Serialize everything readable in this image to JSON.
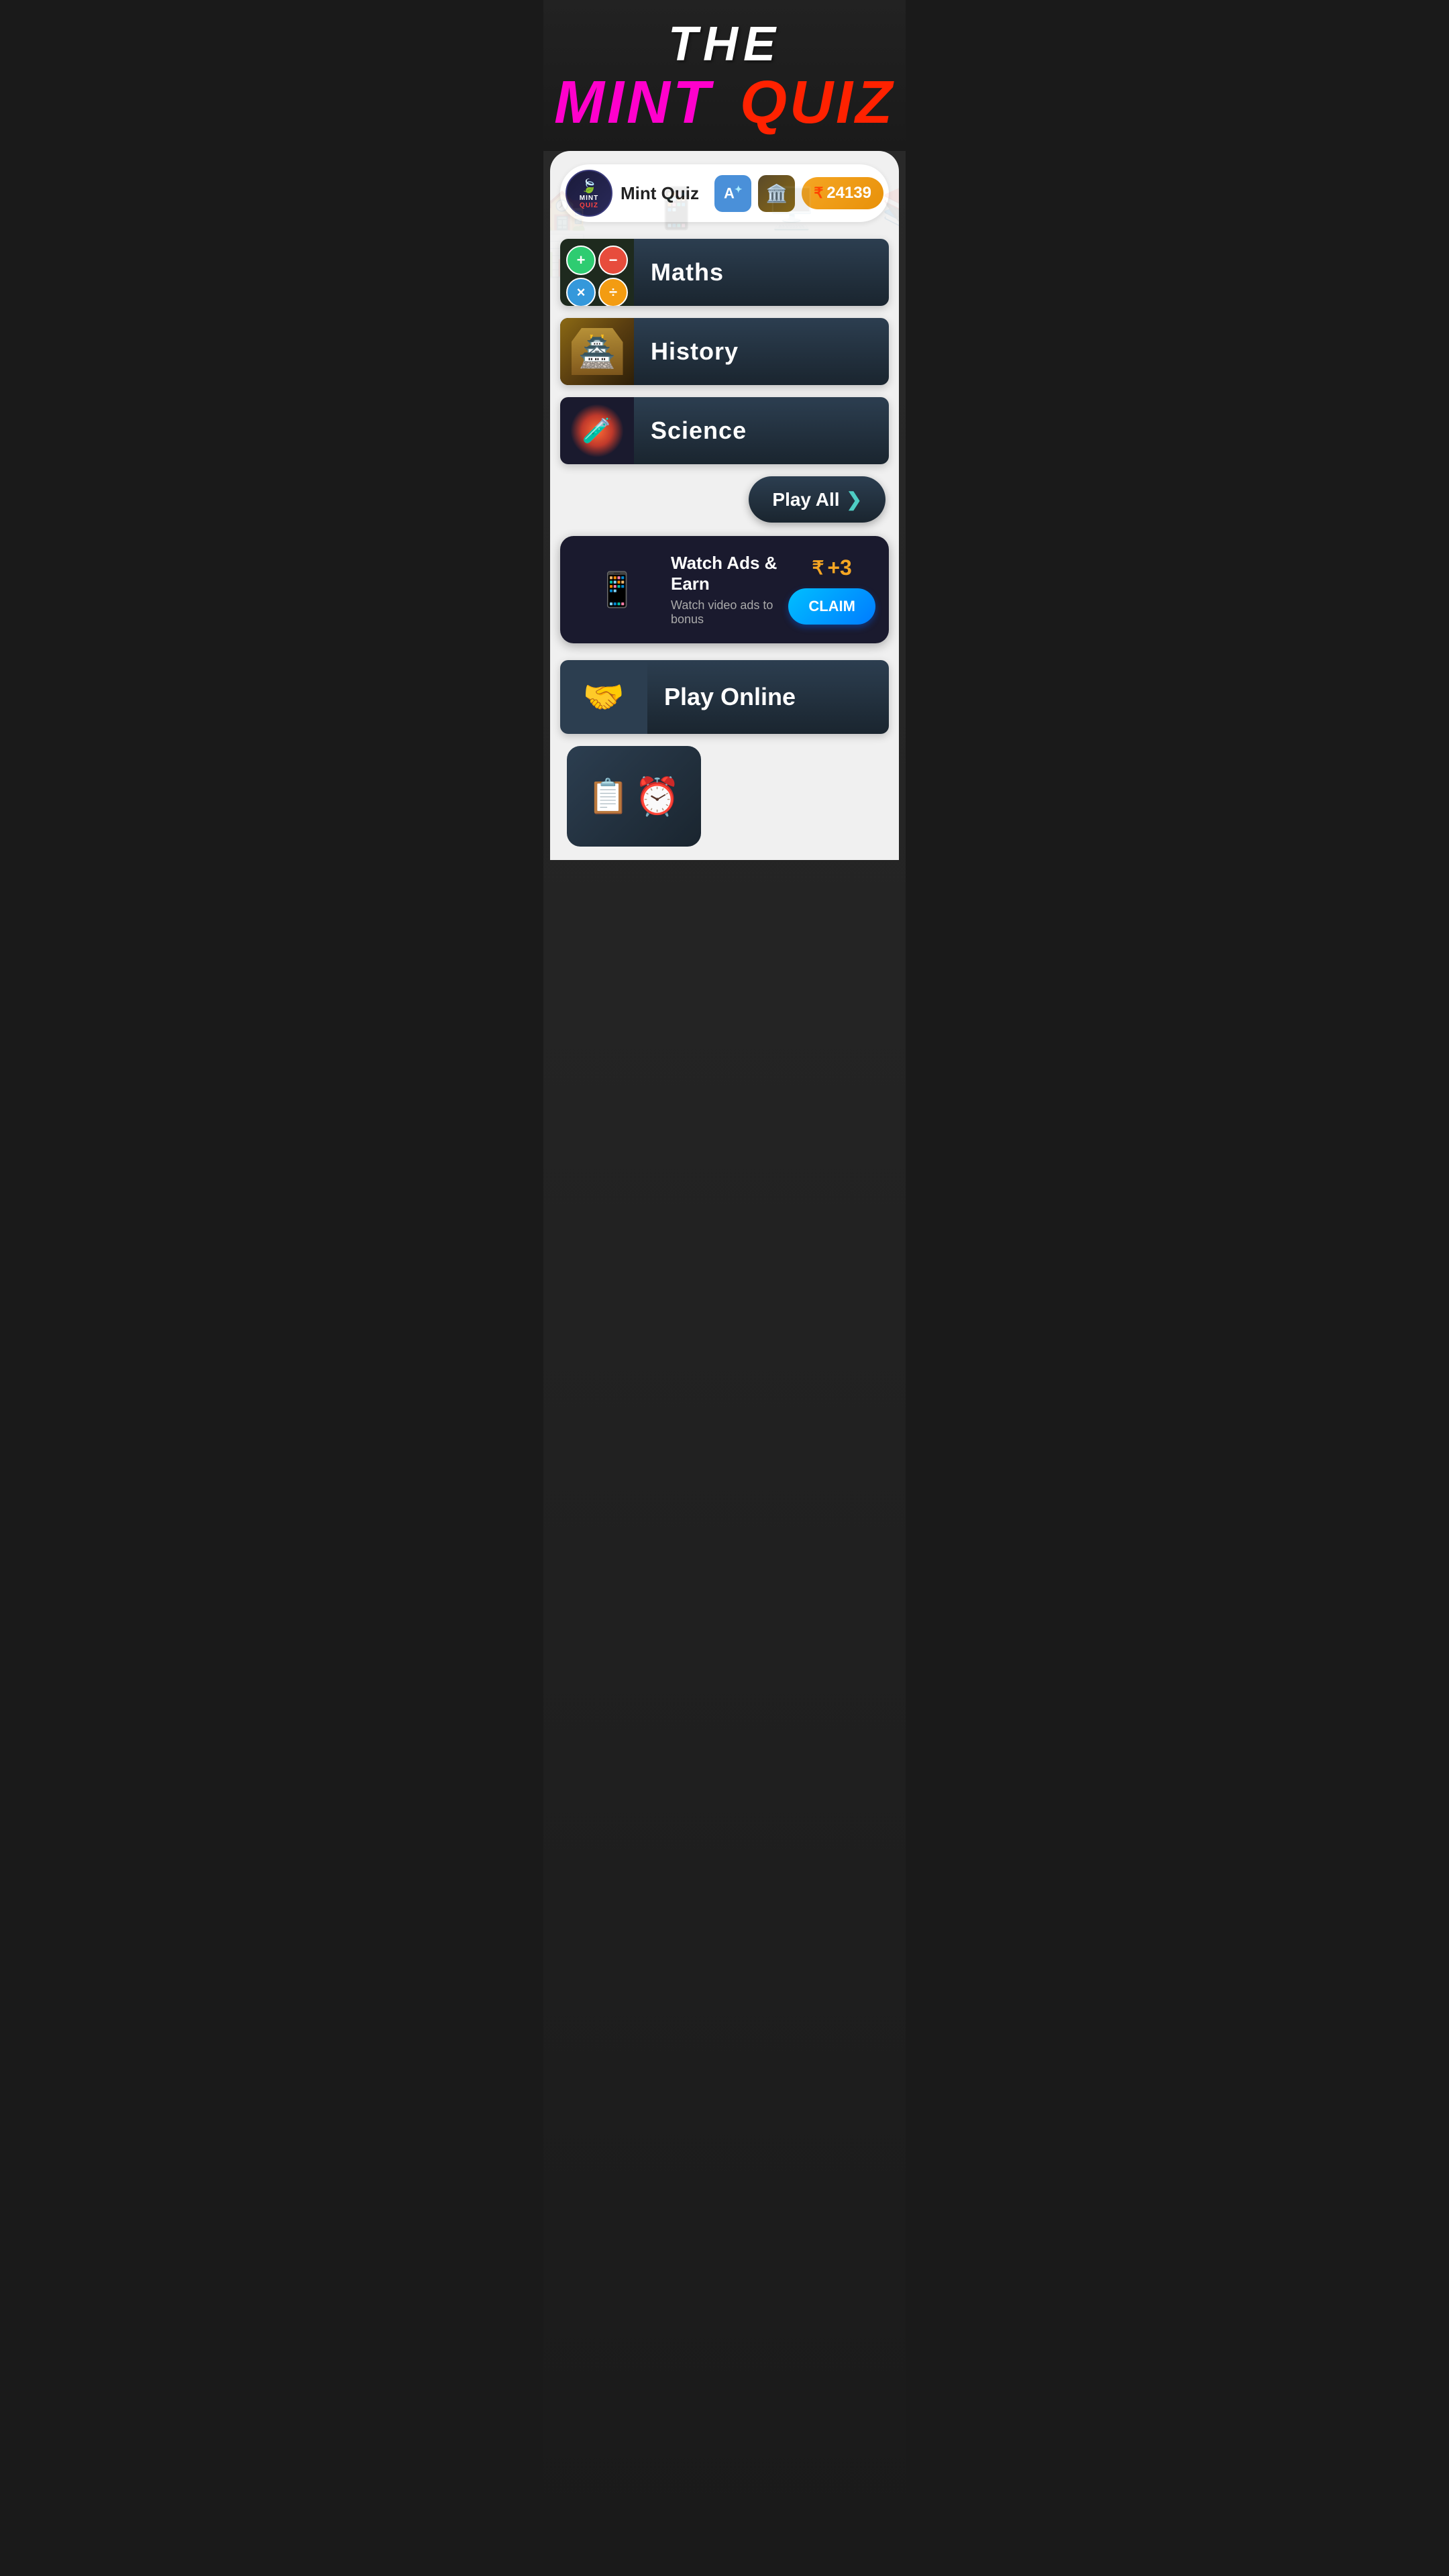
{
  "app": {
    "title": "THE",
    "title_mint": "MINT",
    "title_quiz": "QUIZ",
    "name": "Mint Quiz"
  },
  "header": {
    "coins": "24139",
    "rupee_symbol": "₹"
  },
  "categories": [
    {
      "id": "maths",
      "label": "Maths",
      "icon": "math-operations",
      "thumb_type": "maths"
    },
    {
      "id": "history",
      "label": "History",
      "icon": "temple",
      "thumb_type": "history"
    },
    {
      "id": "science",
      "label": "Science",
      "icon": "science-bottles",
      "thumb_type": "science"
    }
  ],
  "play_all": {
    "label": "Play All",
    "arrow": "❯"
  },
  "ads_banner": {
    "title": "Watch Ads & Earn",
    "subtitle": "Watch video ads to bonus",
    "reward": "+3",
    "claim_label": "CLAIM"
  },
  "play_online": {
    "label": "Play Online"
  },
  "math_symbols": [
    "+",
    "−",
    "×",
    "÷"
  ],
  "icons": {
    "translate": "A",
    "store": "🏛️"
  }
}
